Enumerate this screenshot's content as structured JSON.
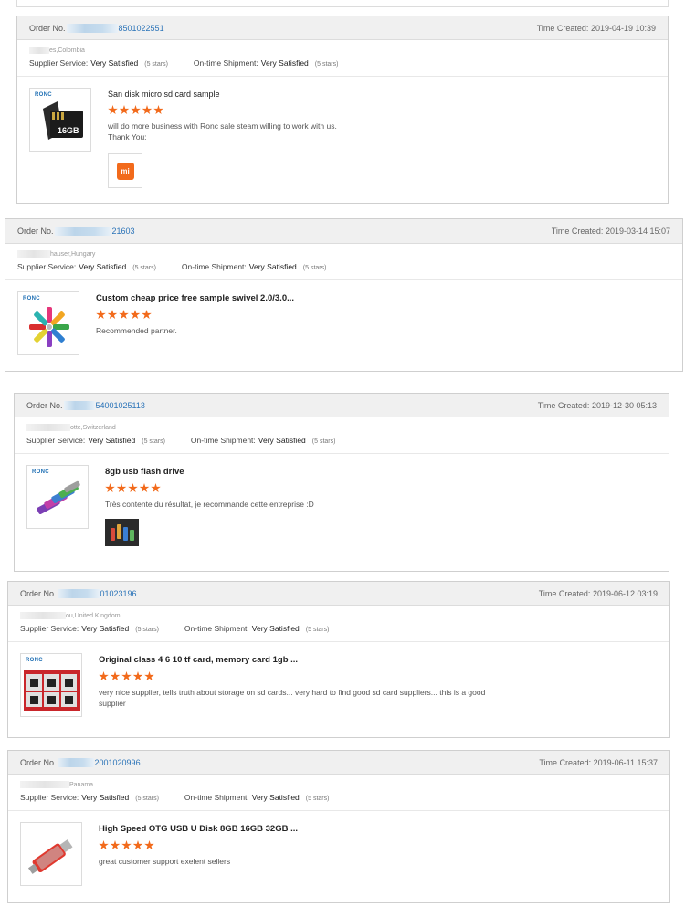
{
  "reviews": [
    {
      "order_label": "Order No.",
      "order_suffix": "8501022551",
      "time_label": "Time Created:",
      "time": "2019-04-19 10:39",
      "country": "es,Colombia",
      "supplier_label": "Supplier Service:",
      "supplier_value": "Very Satisfied",
      "supplier_stars": "(5 stars)",
      "shipment_label": "On-time Shipment:",
      "shipment_value": "Very Satisfied",
      "shipment_stars": "(5 stars)",
      "brand": "RONC",
      "product_image": "microsd-16gb",
      "product_image_text": "16GB",
      "product": "San disk micro sd card sample",
      "rating": 5,
      "comment": "will do more business with Ronc sale steam willing to work with us.",
      "comment2": "Thank You:",
      "attachment": "mi-logo",
      "attachment_text": "mi"
    },
    {
      "order_label": "Order No.",
      "order_suffix": "21603",
      "time_label": "Time Created:",
      "time": "2019-03-14 15:07",
      "country": "hauser,Hungary",
      "supplier_label": "Supplier Service:",
      "supplier_value": "Very Satisfied",
      "supplier_stars": "(5 stars)",
      "shipment_label": "On-time Shipment:",
      "shipment_value": "Very Satisfied",
      "shipment_stars": "(5 stars)",
      "brand": "RONC",
      "product_image": "swivel-usb-fan",
      "product": "Custom cheap price free sample swivel 2.0/3.0...",
      "rating": 5,
      "comment": "Recommended partner."
    },
    {
      "order_label": "Order No.",
      "order_suffix": "54001025113",
      "time_label": "Time Created:",
      "time": "2019-12-30 05:13",
      "country": "otte,Switzerland",
      "supplier_label": "Supplier Service:",
      "supplier_value": "Very Satisfied",
      "supplier_stars": "(5 stars)",
      "shipment_label": "On-time Shipment:",
      "shipment_value": "Very Satisfied",
      "shipment_stars": "(5 stars)",
      "brand": "RONC",
      "product_image": "usb-flash-drives",
      "product": "8gb usb flash drive",
      "rating": 5,
      "comment": "Très contente du résultat, je recommande cette entreprise :D",
      "attachment": "photo"
    },
    {
      "order_label": "Order No.",
      "order_suffix": "01023196",
      "time_label": "Time Created:",
      "time": "2019-06-12 03:19",
      "country": "ou,United Kingdom",
      "supplier_label": "Supplier Service:",
      "supplier_value": "Very Satisfied",
      "supplier_stars": "(5 stars)",
      "shipment_label": "On-time Shipment:",
      "shipment_value": "Very Satisfied",
      "shipment_stars": "(5 stars)",
      "brand": "RONC",
      "product_image": "tf-card-pack",
      "product": "Original class 4 6 10 tf card, memory card 1gb ...",
      "rating": 5,
      "comment": "very nice supplier, tells truth about storage on sd cards... very hard to find good sd card suppliers... this is a good supplier"
    },
    {
      "order_label": "Order No.",
      "order_suffix": "2001020996",
      "time_label": "Time Created:",
      "time": "2019-06-11 15:37",
      "country": "Panama",
      "supplier_label": "Supplier Service:",
      "supplier_value": "Very Satisfied",
      "supplier_stars": "(5 stars)",
      "shipment_label": "On-time Shipment:",
      "shipment_value": "Very Satisfied",
      "shipment_stars": "(5 stars)",
      "product_image": "otg-usb-disk",
      "product": "High Speed OTG USB U Disk 8GB 16GB 32GB ...",
      "rating": 5,
      "comment": "great customer support exelent sellers"
    }
  ],
  "colors": {
    "star": "#f26a1b",
    "order_link": "#2a73b8",
    "header_bg": "#f0f0f0",
    "border": "#cfcfcf"
  }
}
